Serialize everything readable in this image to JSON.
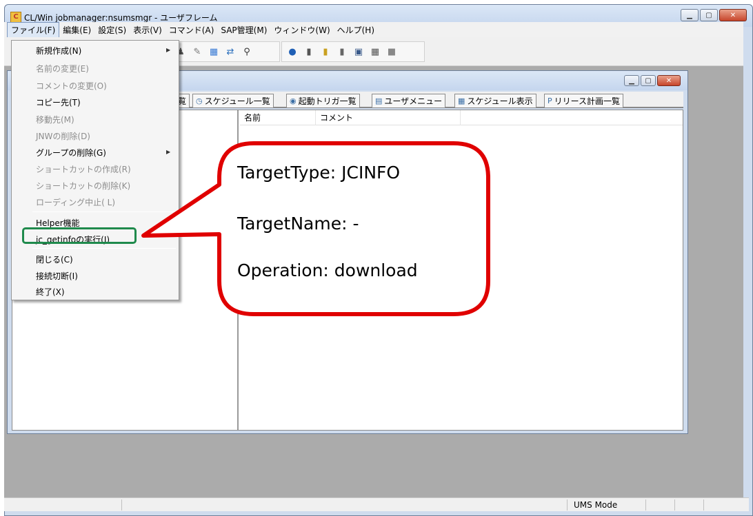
{
  "window": {
    "title": "CL/Win jobmanager:nsumsmgr - ユーザフレーム",
    "icon_label": "C"
  },
  "menubar": {
    "items": [
      "ファイル(F)",
      "編集(E)",
      "設定(S)",
      "表示(V)",
      "コマンド(A)",
      "SAP管理(M)",
      "ウィンドウ(W)",
      "ヘルプ(H)"
    ],
    "active_index": 0
  },
  "file_menu": {
    "items": [
      {
        "label": "新規作成(N)",
        "enabled": true,
        "submenu": true
      },
      {
        "label": "名前の変更(E)",
        "enabled": false,
        "submenu": false
      },
      {
        "label": "コメントの変更(O)",
        "enabled": false,
        "submenu": false
      },
      {
        "label": "コピー先(T)",
        "enabled": true,
        "submenu": false
      },
      {
        "label": "移動先(M)",
        "enabled": false,
        "submenu": false
      },
      {
        "label": "JNWの削除(D)",
        "enabled": false,
        "submenu": false
      },
      {
        "label": "グループの削除(G)",
        "enabled": true,
        "submenu": true
      },
      {
        "label": "ショートカットの作成(R)",
        "enabled": false,
        "submenu": false
      },
      {
        "label": "ショートカットの削除(K)",
        "enabled": false,
        "submenu": false
      },
      {
        "label": "ローディング中止( L)",
        "enabled": false,
        "submenu": false
      },
      {
        "label": "Helper機能",
        "enabled": true,
        "submenu": true
      },
      {
        "label": "jc_getinfoの実行(J)",
        "enabled": true,
        "submenu": false
      },
      {
        "label": "閉じる(C)",
        "enabled": true,
        "submenu": false
      },
      {
        "label": "接続切断(I)",
        "enabled": true,
        "submenu": false
      },
      {
        "label": "終了(X)",
        "enabled": true,
        "submenu": false
      }
    ],
    "highlighted_item": "jc_getinfoの実行(J)"
  },
  "tabs": [
    {
      "label": "覧",
      "icon": "list-icon"
    },
    {
      "label": "スケジュール一覧",
      "icon": "clock-icon"
    },
    {
      "label": "起動トリガ一覧",
      "icon": "trigger-icon"
    },
    {
      "label": "ユーザメニュー",
      "icon": "menu-icon"
    },
    {
      "label": "スケジュール表示",
      "icon": "calendar-icon"
    },
    {
      "label": "リリース計画一覧",
      "icon": "release-icon"
    }
  ],
  "list": {
    "columns": [
      "名前",
      "コメント"
    ]
  },
  "callout": {
    "lines": [
      "TargetType: JCINFO",
      "TargetName: -",
      "Operation: download"
    ],
    "border_color": "#e00000"
  },
  "statusbar": {
    "mode": "UMS Mode"
  },
  "colors": {
    "highlight_box": "#1f8a4c",
    "mdi_background": "#ababab"
  }
}
